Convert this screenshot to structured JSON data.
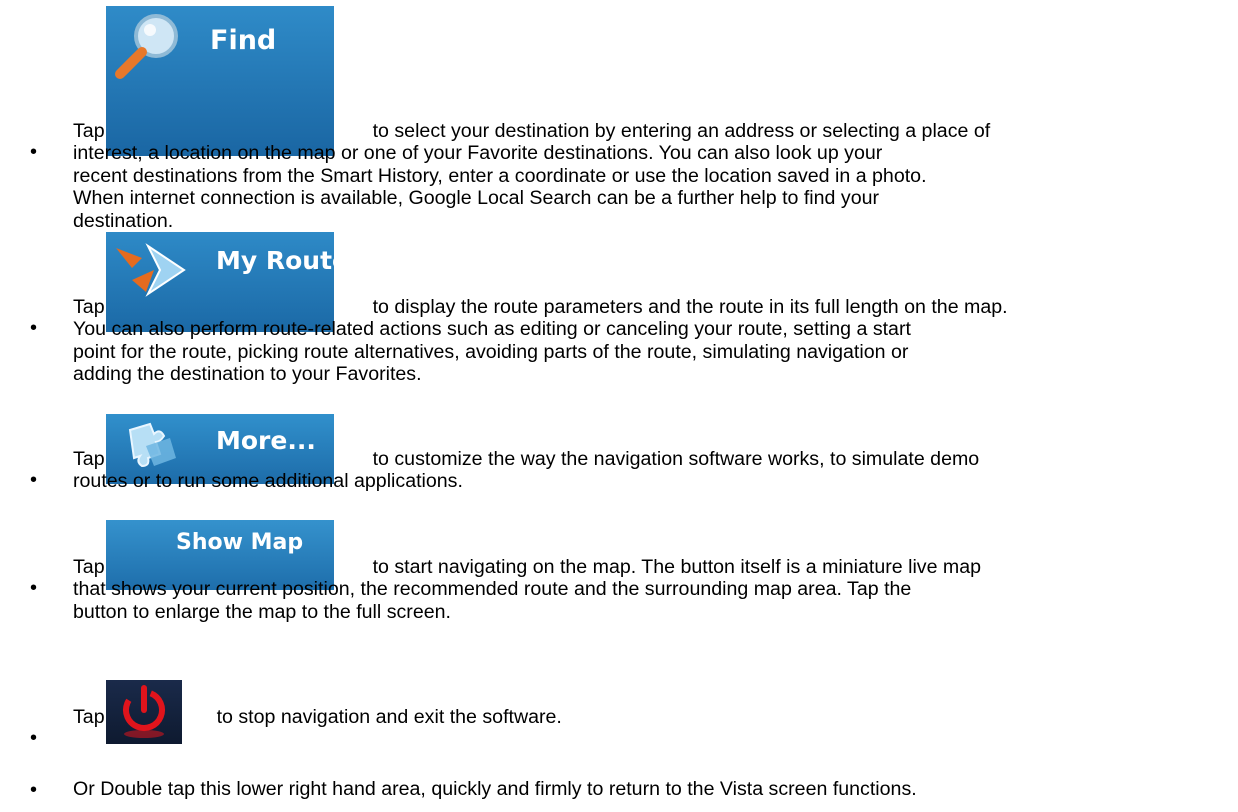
{
  "items": [
    {
      "tap": "Tap",
      "button_label": "Find",
      "button_icon": "magnifier-icon",
      "lines": [
        "to select your destination by entering an address or selecting a place of",
        "interest, a location on the map or one of your Favorite destinations. You can also look up your",
        "recent destinations from the Smart History, enter a coordinate or use the location saved in a photo.",
        "When internet connection is available, Google Local Search can be a further help to find your",
        "destination."
      ]
    },
    {
      "tap": "Tap",
      "button_label": "My Route",
      "button_icon": "route-arrow-icon",
      "lines": [
        "to display the route parameters and the route in its full length on the map.",
        "You can also perform route-related actions such as editing or canceling your route, setting a start",
        "point for the route, picking route alternatives, avoiding parts of the route, simulating navigation or",
        "adding the destination to your Favorites."
      ]
    },
    {
      "tap": "Tap",
      "button_label": "More...",
      "button_icon": "puzzle-icon",
      "lines": [
        "to customize the way the navigation software works, to simulate demo",
        "routes or to run some additional applications."
      ]
    },
    {
      "tap": "Tap",
      "button_label": "Show Map",
      "lines": [
        "to start navigating on the map. The button itself is a miniature live map",
        "that shows your current position, the recommended route and the surrounding map area. Tap the",
        "button to enlarge the map to the full screen."
      ]
    },
    {
      "tap": "Tap",
      "button_icon": "power-icon",
      "lines": [
        "to stop navigation and exit the software."
      ]
    },
    {
      "lines": [
        "Or Double tap this lower right hand area, quickly and firmly to return to the Vista screen functions."
      ]
    }
  ],
  "bullet_char": "•",
  "colors": {
    "button_blue": "#1f72b2",
    "power_bg": "#14203a",
    "power_red": "#e0141c"
  }
}
